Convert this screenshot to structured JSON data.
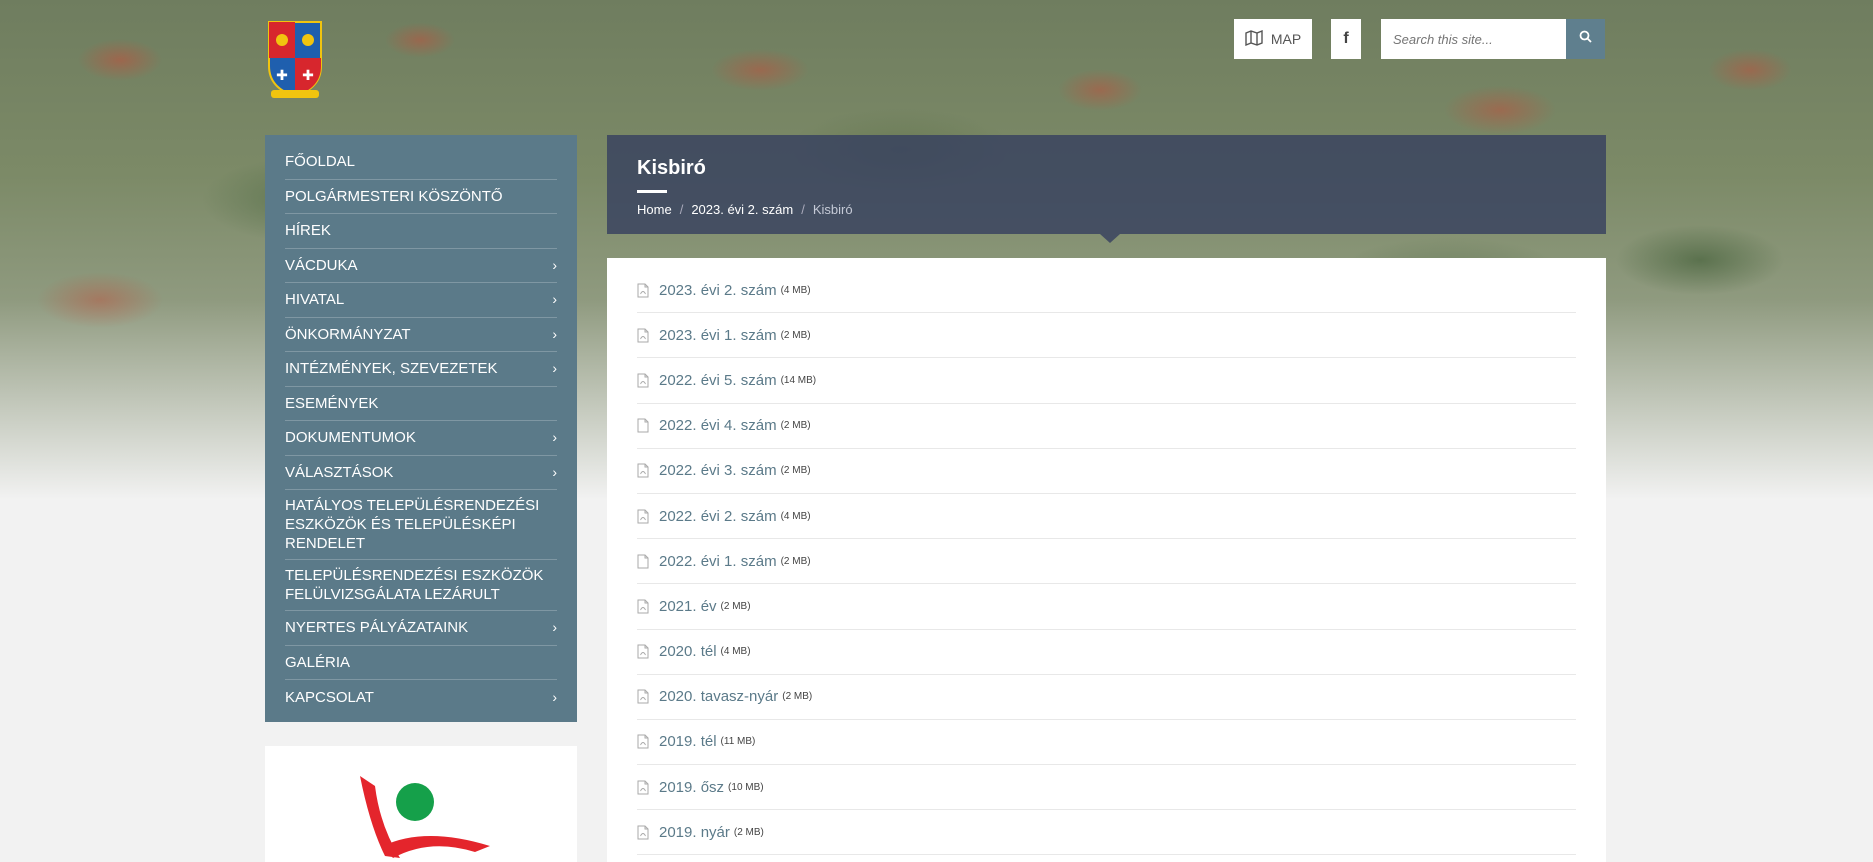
{
  "header": {
    "map_label": "MAP",
    "search_placeholder": "Search this site..."
  },
  "sidebar": {
    "items": [
      {
        "label": "Főoldal",
        "has_children": false
      },
      {
        "label": "Polgármesteri köszöntő",
        "has_children": false
      },
      {
        "label": "Hírek",
        "has_children": false
      },
      {
        "label": "Vácduka",
        "has_children": true
      },
      {
        "label": "Hivatal",
        "has_children": true
      },
      {
        "label": "Önkormányzat",
        "has_children": true
      },
      {
        "label": "Intézmények, szevezetek",
        "has_children": true
      },
      {
        "label": "Események",
        "has_children": false
      },
      {
        "label": "Dokumentumok",
        "has_children": true
      },
      {
        "label": "Választások",
        "has_children": true
      },
      {
        "label": "Hatályos településrendezési eszközök és településképi rendelet",
        "has_children": false
      },
      {
        "label": "Településrendezési eszközök felülvizsgálata lezárult",
        "has_children": false
      },
      {
        "label": "Nyertes pályázataink",
        "has_children": true
      },
      {
        "label": "Galéria",
        "has_children": false
      },
      {
        "label": "Kapcsolat",
        "has_children": true
      }
    ]
  },
  "page": {
    "title": "Kisbiró",
    "breadcrumb": [
      "Home",
      "2023. évi 2. szám",
      "Kisbiró"
    ]
  },
  "files": [
    {
      "name": "2023. évi 2. szám",
      "size": "(4 MB)",
      "icon": "pdf-file-icon"
    },
    {
      "name": "2023. évi 1. szám",
      "size": "(2 MB)",
      "icon": "pdf-file-icon"
    },
    {
      "name": "2022. évi 5. szám",
      "size": "(14 MB)",
      "icon": "pdf-file-icon"
    },
    {
      "name": "2022. évi 4. szám",
      "size": "(2 MB)",
      "icon": "file-icon"
    },
    {
      "name": "2022. évi 3. szám",
      "size": "(2 MB)",
      "icon": "pdf-file-icon"
    },
    {
      "name": "2022. évi 2. szám",
      "size": "(4 MB)",
      "icon": "pdf-file-icon"
    },
    {
      "name": "2022. évi 1. szám",
      "size": "(2 MB)",
      "icon": "file-icon"
    },
    {
      "name": "2021. év",
      "size": "(2 MB)",
      "icon": "pdf-file-icon"
    },
    {
      "name": "2020. tél",
      "size": "(4 MB)",
      "icon": "pdf-file-icon"
    },
    {
      "name": "2020. tavasz-nyár",
      "size": "(2 MB)",
      "icon": "pdf-file-icon"
    },
    {
      "name": "2019. tél",
      "size": "(11 MB)",
      "icon": "pdf-file-icon"
    },
    {
      "name": "2019. ősz",
      "size": "(10 MB)",
      "icon": "pdf-file-icon"
    },
    {
      "name": "2019. nyár",
      "size": "(2 MB)",
      "icon": "pdf-file-icon"
    }
  ],
  "colors": {
    "accent": "#5b7a89",
    "header_overlay": "#37415f"
  }
}
